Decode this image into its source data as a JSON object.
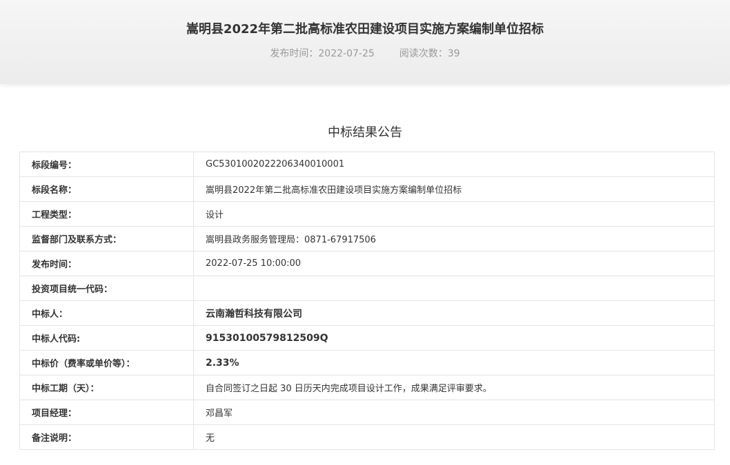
{
  "header": {
    "title": "嵩明县2022年第二批高标准农田建设项目实施方案编制单位招标",
    "publish_label": "发布时间：",
    "publish_date": "2022-07-25",
    "views_label": "阅读次数：",
    "views": "39"
  },
  "section_title": "中标结果公告",
  "rows": [
    {
      "label": "标段编号：",
      "value": "GC5301002022206340010001"
    },
    {
      "label": "标段名称：",
      "value": "嵩明县2022年第二批高标准农田建设项目实施方案编制单位招标"
    },
    {
      "label": "工程类型：",
      "value": "设计"
    },
    {
      "label": "监督部门及联系方式：",
      "value": "嵩明县政务服务管理局：0871-67917506"
    },
    {
      "label": "发布时间：",
      "value": "2022-07-25 10:00:00"
    },
    {
      "label": "投资项目统一代码：",
      "value": ""
    },
    {
      "label": "中标人：",
      "value": "云南瀚哲科技有限公司"
    },
    {
      "label": "中标人代码:",
      "value": "91530100579812509Q"
    },
    {
      "label": "中标价（费率或单价等）：",
      "value": "2.33%"
    },
    {
      "label": "中标工期（天）：",
      "value": "自合同签订之日起 30 日历天内完成项目设计工作，成果满足评审要求。"
    },
    {
      "label": "项目经理：",
      "value": "邓昌军"
    },
    {
      "label": "备注说明：",
      "value": "无"
    }
  ]
}
